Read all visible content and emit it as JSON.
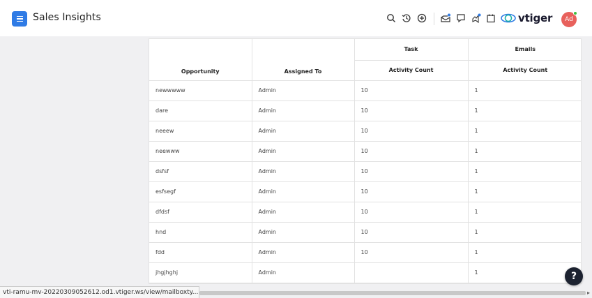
{
  "header": {
    "title": "Sales Insights",
    "brand": "vtiger",
    "avatar_initials": "Ad",
    "icons": [
      "search-icon",
      "history-icon",
      "add-icon",
      "mail-icon",
      "chat-icon",
      "activity-icon",
      "calendar-icon"
    ]
  },
  "table": {
    "group_headers": {
      "task": "Task",
      "emails": "Emails"
    },
    "columns": {
      "opportunity": "Opportunity",
      "assigned_to": "Assigned To",
      "task_activity": "Activity Count",
      "email_activity": "Activity Count"
    },
    "rows": [
      {
        "opportunity": "newwwww",
        "assigned_to": "Admin",
        "task_count": "10",
        "email_count": "1"
      },
      {
        "opportunity": "dare",
        "assigned_to": "Admin",
        "task_count": "10",
        "email_count": "1"
      },
      {
        "opportunity": "neeew",
        "assigned_to": "Admin",
        "task_count": "10",
        "email_count": "1"
      },
      {
        "opportunity": "neewww",
        "assigned_to": "Admin",
        "task_count": "10",
        "email_count": "1"
      },
      {
        "opportunity": "dsfsf",
        "assigned_to": "Admin",
        "task_count": "10",
        "email_count": "1"
      },
      {
        "opportunity": "esfsegf",
        "assigned_to": "Admin",
        "task_count": "10",
        "email_count": "1"
      },
      {
        "opportunity": "dfdsf",
        "assigned_to": "Admin",
        "task_count": "10",
        "email_count": "1"
      },
      {
        "opportunity": "hnd",
        "assigned_to": "Admin",
        "task_count": "10",
        "email_count": "1"
      },
      {
        "opportunity": "fdd",
        "assigned_to": "Admin",
        "task_count": "10",
        "email_count": "1"
      },
      {
        "opportunity": "jhgjhghj",
        "assigned_to": "Admin",
        "task_count": "",
        "email_count": "1"
      }
    ]
  },
  "help_button": "?",
  "statusbar": {
    "url": "vti-ramu-mv-20220309052612.od1.vtiger.ws/view/mailboxty..."
  },
  "colors": {
    "primary": "#2f7be5",
    "avatar": "#e8615c",
    "help": "#1c2230"
  }
}
